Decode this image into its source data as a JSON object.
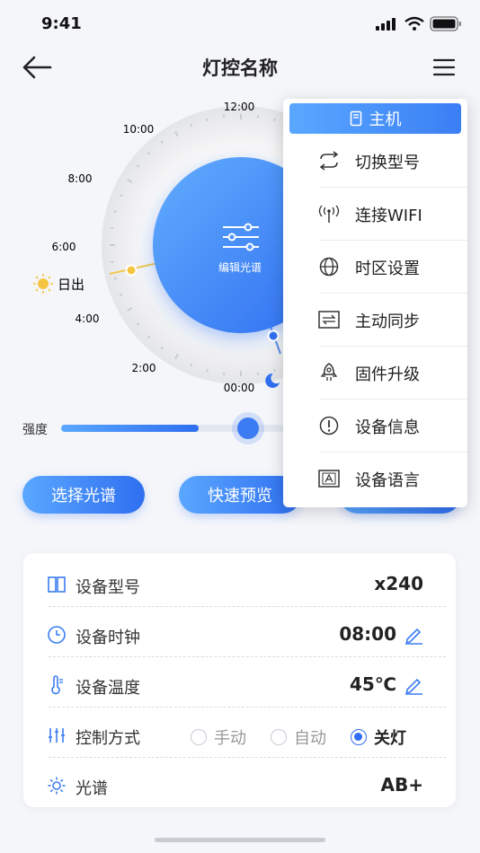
{
  "status_bar": {
    "time": "9:41"
  },
  "nav": {
    "title": "灯控名称"
  },
  "dial": {
    "hours": [
      "12:00",
      "10:00",
      "8:00",
      "6:00",
      "4:00",
      "2:00",
      "00:00"
    ],
    "sunrise_label": "日出",
    "center_label": "编辑光谱"
  },
  "intensity": {
    "label": "强度",
    "level_percent": 68
  },
  "buttons": {
    "select_spectrum": "选择光谱",
    "quick_preview": "快速预览"
  },
  "device": {
    "model": {
      "label": "设备型号",
      "value": "x240"
    },
    "clock": {
      "label": "设备时钟",
      "value": "08:00"
    },
    "temperature": {
      "label": "设备温度",
      "value": "45℃"
    },
    "control": {
      "label": "控制方式",
      "options": [
        "手动",
        "自动",
        "关灯"
      ],
      "selected": "关灯"
    },
    "spectrum": {
      "label": "光谱",
      "value": "AB+"
    }
  },
  "menu": {
    "header": "主机",
    "items": [
      {
        "label": "切换型号",
        "icon": "switch-icon"
      },
      {
        "label": "连接WIFI",
        "icon": "antenna-icon"
      },
      {
        "label": "时区设置",
        "icon": "globe-icon"
      },
      {
        "label": "主动同步",
        "icon": "sync-icon"
      },
      {
        "label": "固件升级",
        "icon": "rocket-icon"
      },
      {
        "label": "设备信息",
        "icon": "info-icon"
      },
      {
        "label": "设备语言",
        "icon": "language-icon"
      }
    ]
  },
  "colors": {
    "accent": "#2f6ff0",
    "accent_light": "#5aa7ff",
    "sunrise_line": "#f2c94c"
  }
}
